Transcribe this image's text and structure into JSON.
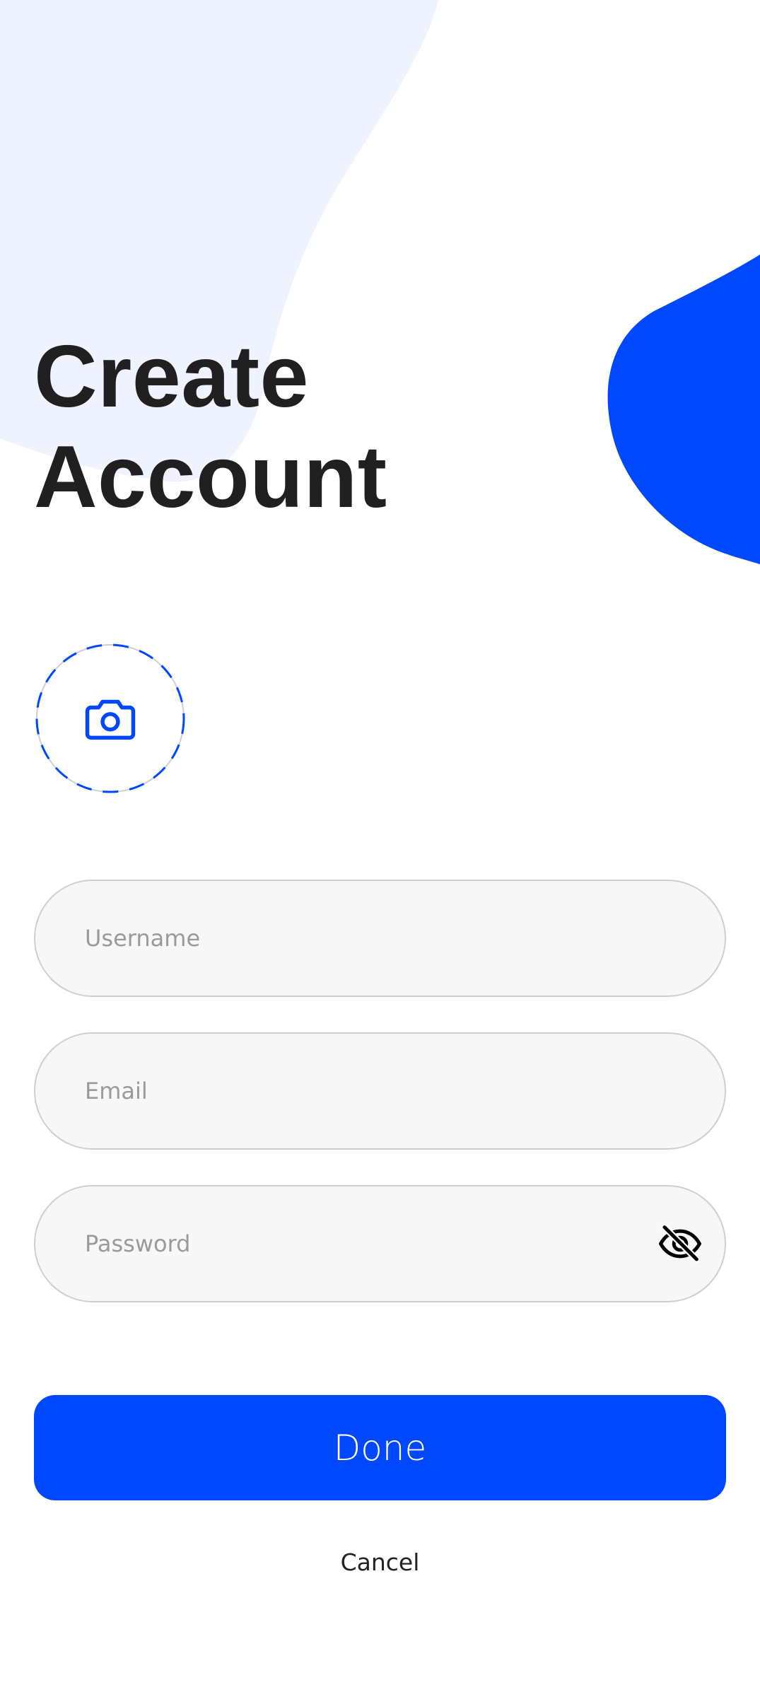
{
  "title": {
    "line1": "Create",
    "line2": "Account"
  },
  "avatar": {
    "icon": "camera-icon"
  },
  "form": {
    "username": {
      "placeholder": "Username",
      "value": ""
    },
    "email": {
      "placeholder": "Email",
      "value": ""
    },
    "password": {
      "placeholder": "Password",
      "value": "",
      "toggle_icon": "eye-off-icon"
    }
  },
  "actions": {
    "done_label": "Done",
    "cancel_label": "Cancel"
  },
  "colors": {
    "accent": "#0048ff",
    "background_blob": "#eff3ff",
    "title_text": "#202020",
    "field_bg": "#f7f7f7",
    "field_border": "#cfcfcf",
    "placeholder": "#9a9a9a"
  }
}
